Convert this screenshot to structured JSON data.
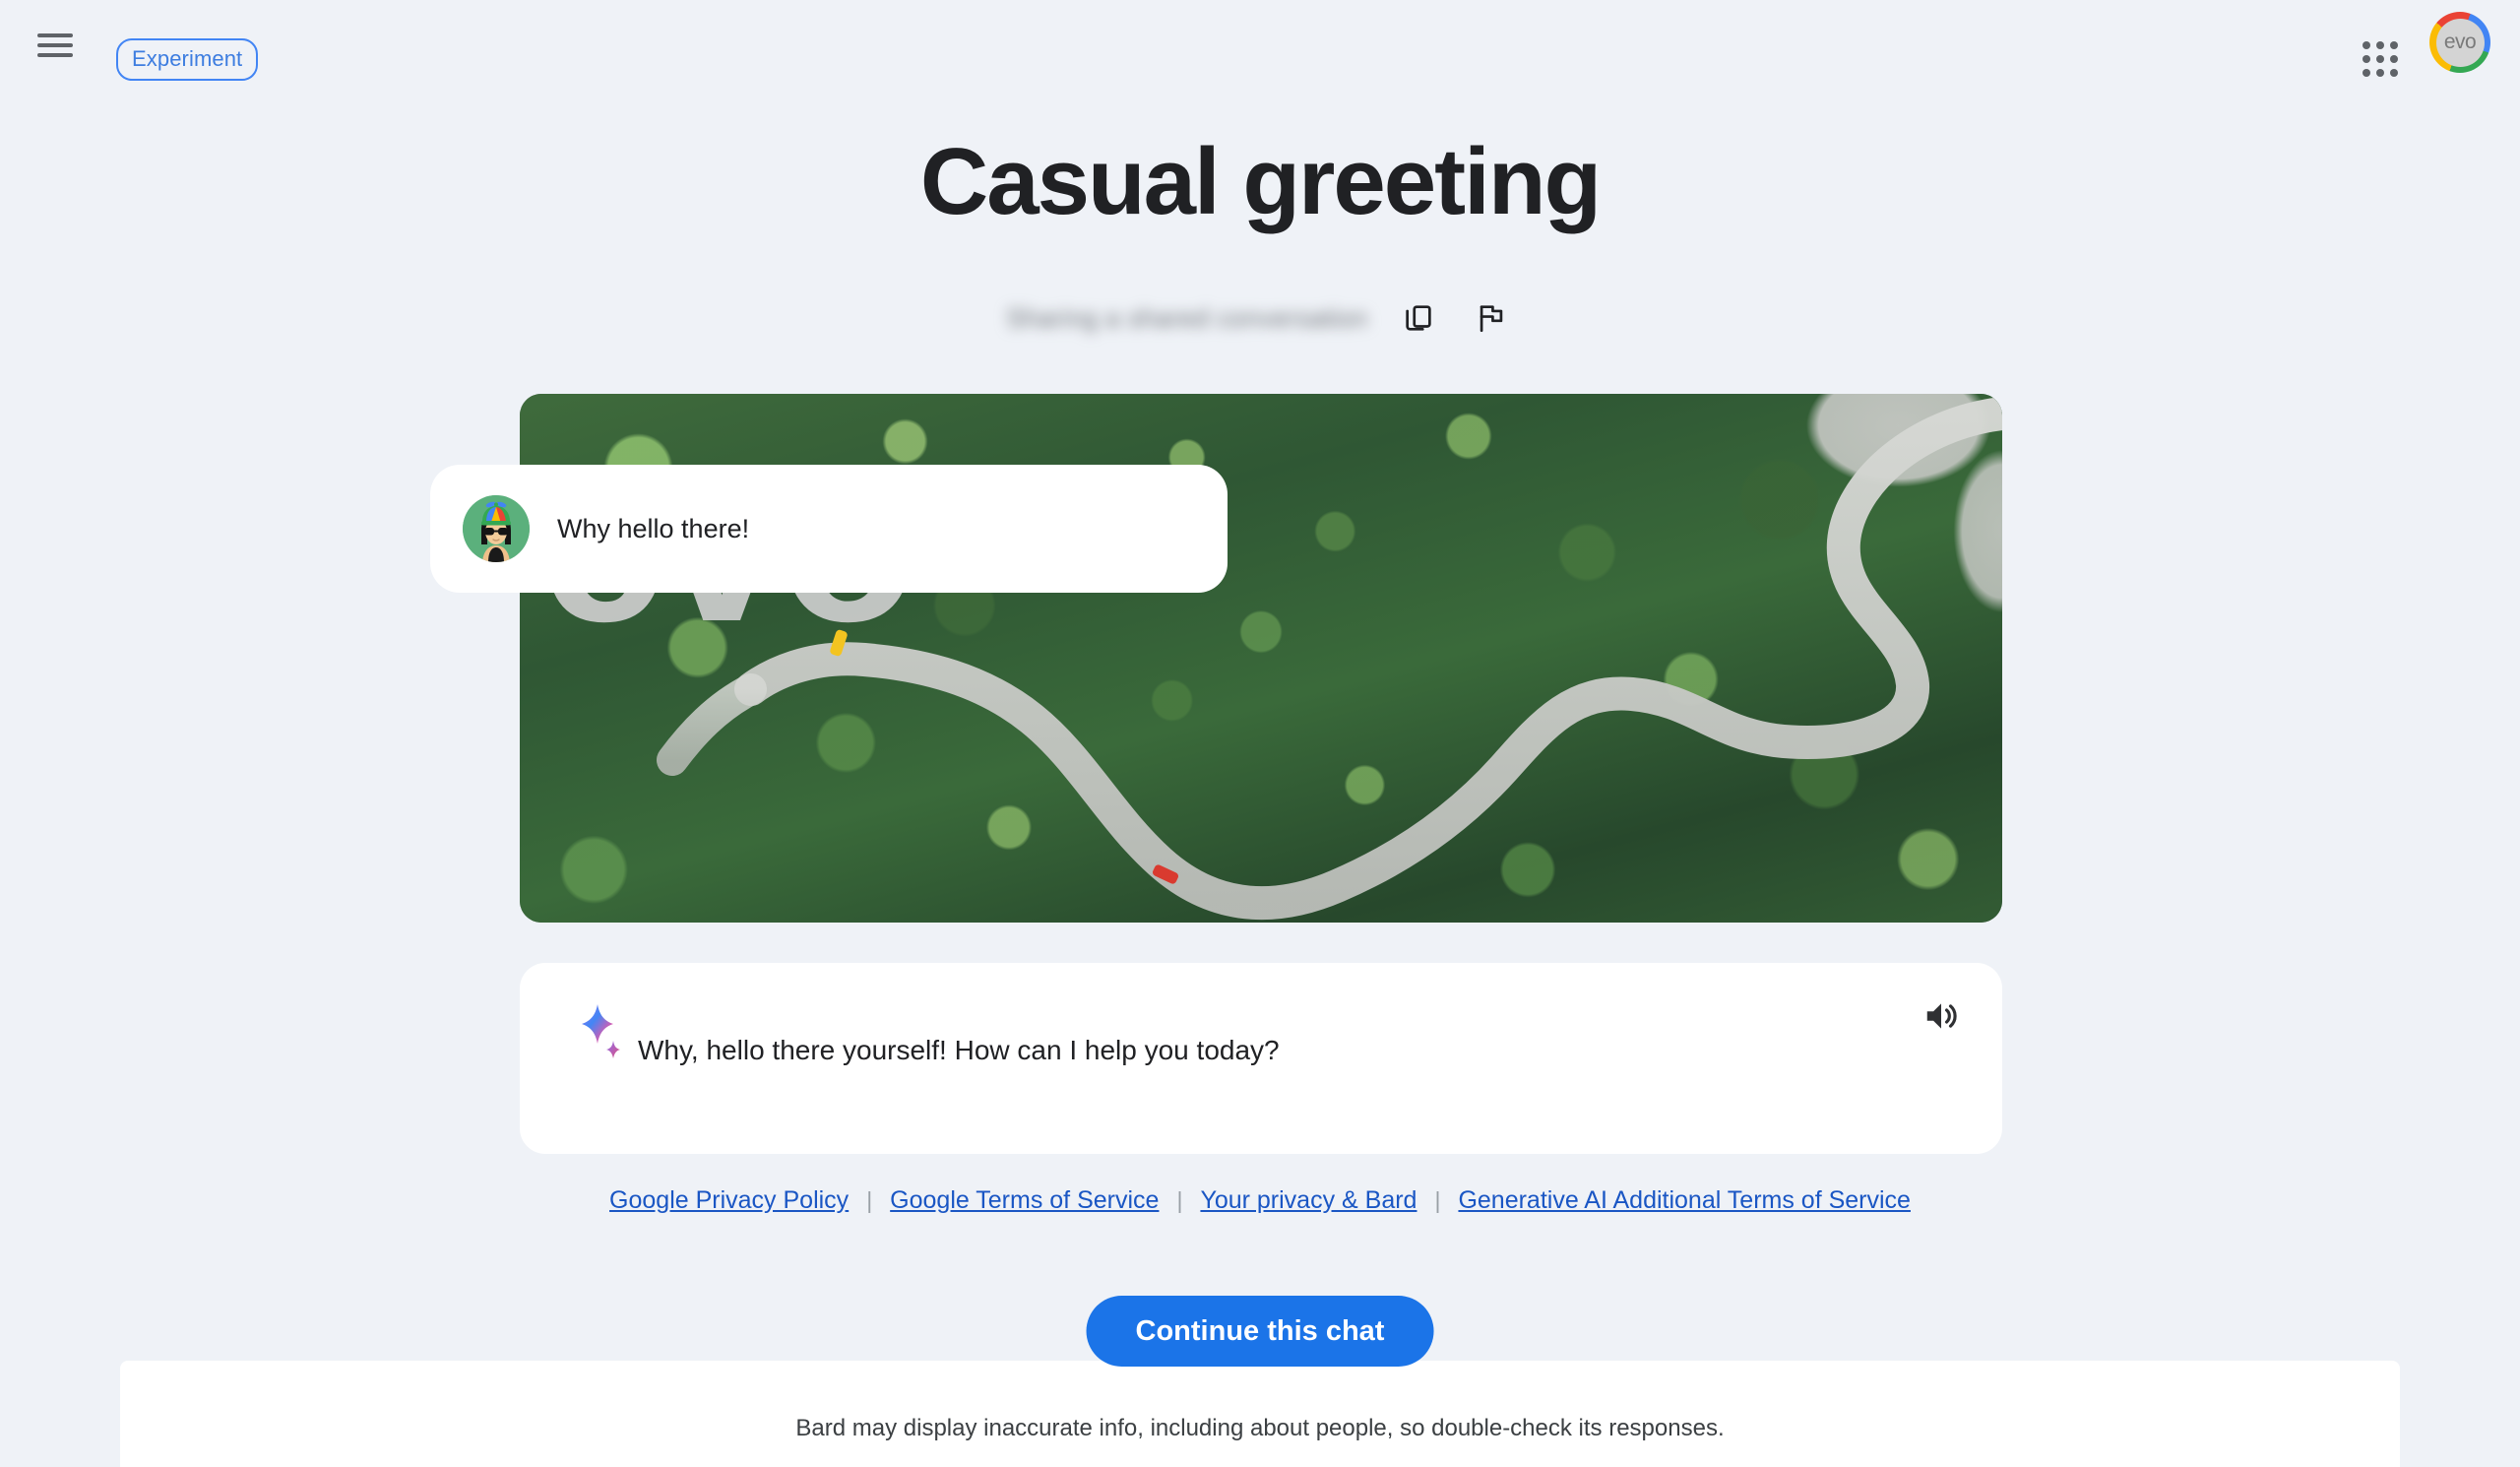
{
  "app": {
    "background_color": "#eff2f7",
    "accent_color": "#1b74e8"
  },
  "topbar": {
    "menu_icon": "hamburger-menu-icon",
    "experiment_label": "Experiment",
    "apps_icon": "google-apps-grid-icon",
    "avatar_label": "evo",
    "avatar_icon": "user-avatar"
  },
  "header": {
    "title": "Casual greeting",
    "subtitle_redacted": "Sharing a shared conversation",
    "copy_icon": "copy-icon",
    "report_icon": "flag-report-icon"
  },
  "hero": {
    "alt": "Aerial view of a winding road through a dense green forest",
    "watermark": "evo"
  },
  "conversation": {
    "user_message": {
      "avatar_icon": "user-avatar-beanie",
      "text": "Why hello there!"
    },
    "bard_response": {
      "sparkle_icon": "bard-sparkle-icon",
      "text": "Why, hello there yourself! How can I help you today?",
      "speaker_icon": "volume-up-icon"
    }
  },
  "legal": {
    "separator": "|",
    "links": [
      {
        "label": "Google Privacy Policy"
      },
      {
        "label": "Google Terms of Service"
      },
      {
        "label": "Your privacy & Bard"
      },
      {
        "label": "Generative AI Additional Terms of Service"
      }
    ]
  },
  "actions": {
    "continue_label": "Continue this chat"
  },
  "footer": {
    "disclaimer": "Bard may display inaccurate info, including about people, so double-check its responses."
  }
}
